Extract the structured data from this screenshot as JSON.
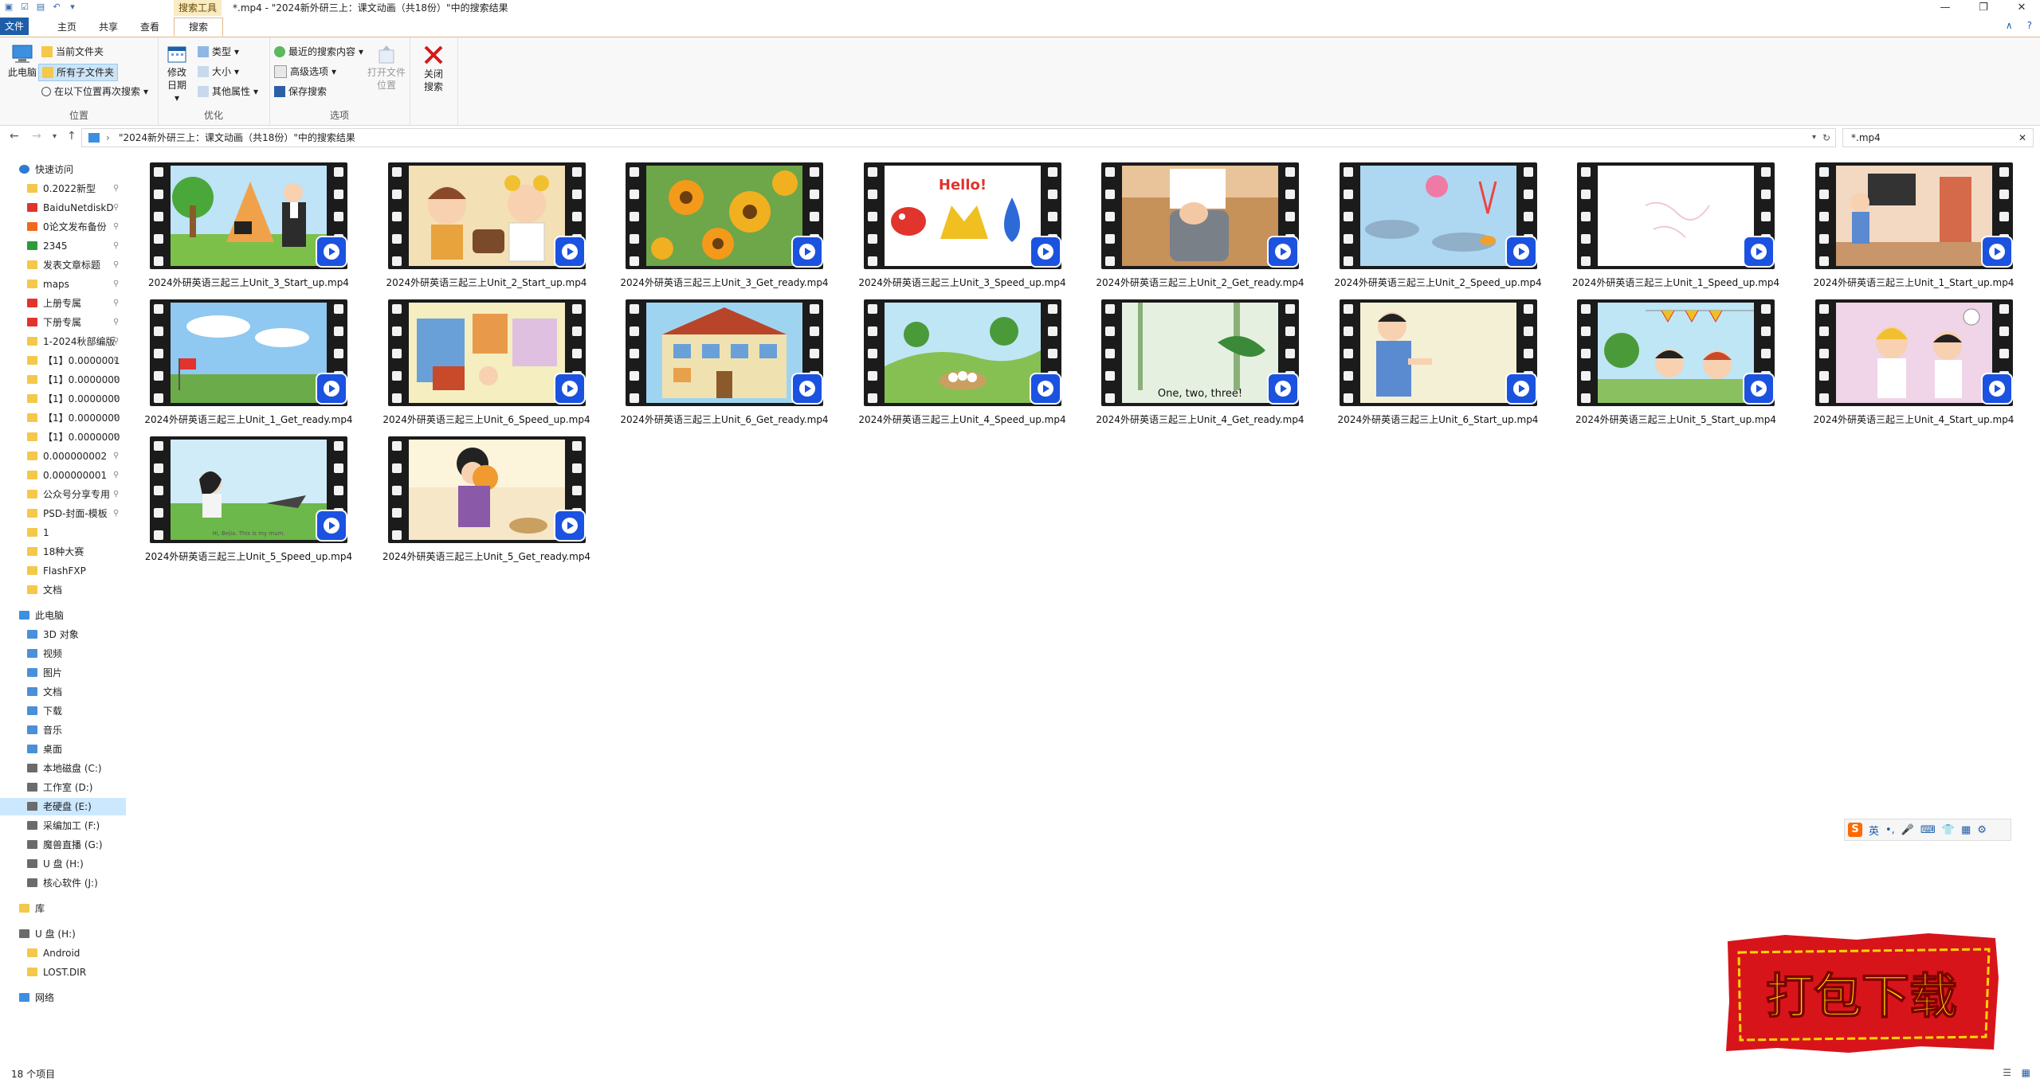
{
  "title_bar": {
    "context_tab": "搜索工具",
    "window_title": "*.mp4 - \"2024新外研三上：课文动画（共18份）\"中的搜索结果"
  },
  "ribbon_tabs": [
    "文件",
    "主页",
    "共享",
    "查看",
    "搜索"
  ],
  "ribbon": {
    "location": {
      "this_pc": "此电脑",
      "current_folder": "当前文件夹",
      "all_subfolders": "所有子文件夹",
      "search_again": "在以下位置再次搜索",
      "label": "位置"
    },
    "refine": {
      "date_modified": "修改日期",
      "kind": "类型",
      "size": "大小",
      "other_properties": "其他属性",
      "label": "优化"
    },
    "options": {
      "recent_searches": "最近的搜索内容",
      "advanced_options": "高级选项",
      "save_search": "保存搜索",
      "open_file_location": "打开文件位置",
      "label": "选项"
    },
    "close_search": "关闭搜索"
  },
  "address": {
    "path": "\"2024新外研三上：课文动画（共18份）\"中的搜索结果",
    "search_value": "*.mp4"
  },
  "nav": {
    "quick_access": "快速访问",
    "quick_items": [
      "0.2022新型",
      "BaiduNetdiskD",
      "0论文发布备份",
      "2345",
      "发表文章标题",
      "maps",
      "上册专属",
      "下册专属",
      "1-2024秋部编版",
      "【1】0.0000001",
      "【1】0.0000000",
      "【1】0.0000000",
      "【1】0.0000000",
      "【1】0.0000000",
      "0.000000002",
      "0.000000001",
      "公众号分享专用",
      "PSD-封面-模板",
      "1",
      "18种大赛",
      "FlashFXP",
      "文档"
    ],
    "this_pc": "此电脑",
    "pc_items": [
      "3D 对象",
      "视频",
      "图片",
      "文档",
      "下载",
      "音乐",
      "桌面",
      "本地磁盘 (C:)",
      "工作室 (D:)",
      "老硬盘 (E:)",
      "采编加工 (F:)",
      "魔兽直播 (G:)",
      "U 盘 (H:)",
      "核心软件 (J:)"
    ],
    "usb": "U 盘 (H:)",
    "usb_items": [
      "Android",
      "LOST.DIR"
    ],
    "network": "网络",
    "library": "库"
  },
  "files": [
    {
      "name": "2024外研英语三起三上Unit_3_Start_up.mp4",
      "scene": "magic"
    },
    {
      "name": "2024外研英语三起三上Unit_2_Start_up.mp4",
      "scene": "kids"
    },
    {
      "name": "2024外研英语三起三上Unit_3_Get_ready.mp4",
      "scene": "flowers"
    },
    {
      "name": "2024外研英语三起三上Unit_3_Speed_up.mp4",
      "scene": "hello"
    },
    {
      "name": "2024外研英语三起三上Unit_2_Get_ready.mp4",
      "scene": "bag"
    },
    {
      "name": "2024外研英语三起三上Unit_2_Speed_up.mp4",
      "scene": "sea"
    },
    {
      "name": "2024外研英语三起三上Unit_1_Speed_up.mp4",
      "scene": "blank"
    },
    {
      "name": "2024外研英语三起三上Unit_1_Start_up.mp4",
      "scene": "room"
    },
    {
      "name": "2024外研英语三起三上Unit_1_Get_ready.mp4",
      "scene": "sky"
    },
    {
      "name": "2024外研英语三起三上Unit_6_Speed_up.mp4",
      "scene": "house"
    },
    {
      "name": "2024外研英语三起三上Unit_6_Get_ready.mp4",
      "scene": "building"
    },
    {
      "name": "2024外研英语三起三上Unit_4_Speed_up.mp4",
      "scene": "eggs"
    },
    {
      "name": "2024外研英语三起三上Unit_4_Get_ready.mp4",
      "scene": "forest"
    },
    {
      "name": "2024外研英语三起三上Unit_6_Start_up.mp4",
      "scene": "man"
    },
    {
      "name": "2024外研英语三起三上Unit_5_Start_up.mp4",
      "scene": "boys"
    },
    {
      "name": "2024外研英语三起三上Unit_4_Start_up.mp4",
      "scene": "pink"
    },
    {
      "name": "2024外研英语三起三上Unit_5_Speed_up.mp4",
      "scene": "park"
    },
    {
      "name": "2024外研英语三起三上Unit_5_Get_ready.mp4",
      "scene": "girl"
    }
  ],
  "thumb_text": {
    "hello": "Hello!",
    "forest": "One, two, three!",
    "park": "Hi, Bejia. This is my mum."
  },
  "status": "18 个项目",
  "ime": {
    "lang": "英"
  },
  "stamp_text": "打包下载",
  "colors": {
    "accent": "#1e5ea8",
    "selection": "#cce8ff",
    "play_badge": "#1b52e0",
    "stamp_red": "#d8141b",
    "stamp_text": "#ffd400"
  }
}
